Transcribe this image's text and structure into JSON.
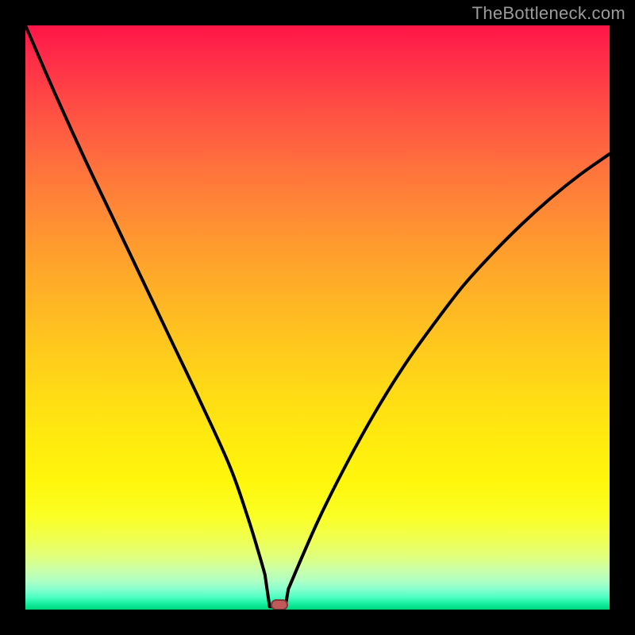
{
  "watermark": "TheBottleneck.com",
  "colors": {
    "curve_stroke": "#000000",
    "marker_fill": "#c05a5a",
    "marker_stroke": "#7e3a3a",
    "background_black": "#000000"
  },
  "chart_data": {
    "type": "line",
    "title": "",
    "xlabel": "",
    "ylabel": "",
    "xlim": [
      0,
      100
    ],
    "ylim": [
      0,
      100
    ],
    "series": [
      {
        "name": "bottleneck-curve",
        "x": [
          0,
          5,
          10,
          15,
          20,
          25,
          30,
          35,
          38,
          40,
          41,
          42,
          43,
          44,
          45,
          50,
          55,
          60,
          65,
          70,
          75,
          80,
          85,
          90,
          95,
          100
        ],
        "y": [
          100,
          88.5,
          77.5,
          67,
          56.5,
          46,
          35.5,
          24.5,
          16,
          9.5,
          6,
          3,
          0.5,
          0.5,
          3.5,
          15,
          25,
          34,
          42,
          49,
          55.5,
          61,
          66,
          70.5,
          74.5,
          78
        ]
      }
    ],
    "flat_segment": {
      "x_start": 41.8,
      "x_end": 44.5,
      "y": 0.5
    },
    "marker": {
      "x": 43.5,
      "y": 0.8
    },
    "background_gradient": {
      "type": "vertical",
      "stops": [
        {
          "pos": 0.0,
          "color": "#ff1547"
        },
        {
          "pos": 0.5,
          "color": "#ffc61e"
        },
        {
          "pos": 0.88,
          "color": "#efff52"
        },
        {
          "pos": 1.0,
          "color": "#03d57b"
        }
      ]
    }
  }
}
